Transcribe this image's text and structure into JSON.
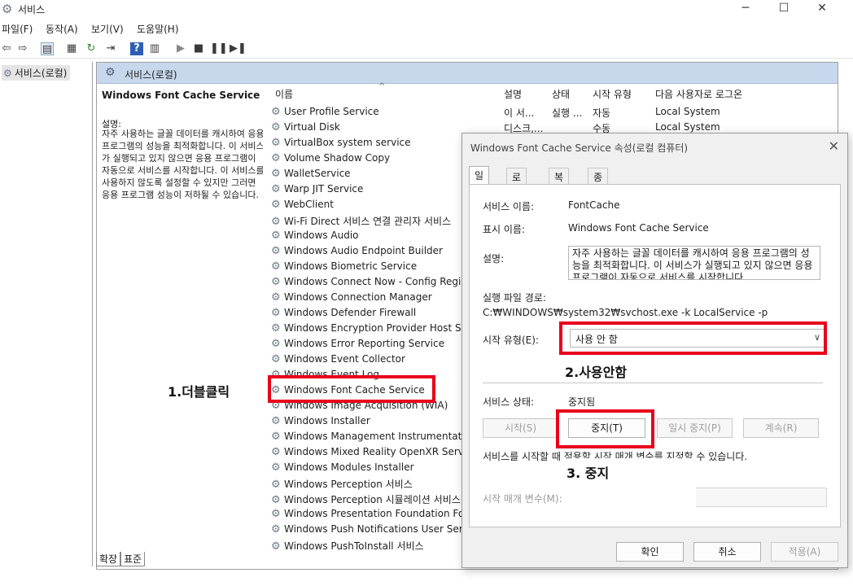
{
  "window": {
    "title": "서비스",
    "minimize": "─",
    "maximize": "☐",
    "close": "✕"
  },
  "menu": [
    "파일(F)",
    "동작(A)",
    "보기(V)",
    "도움말(H)"
  ],
  "tree": {
    "root": "서비스(로컬)"
  },
  "pane": {
    "header": "서비스(로컬)",
    "selected_name": "Windows Font Cache Service",
    "desc_label": "설명:",
    "desc_text": "자주 사용하는 글꼴 데이터를 캐시하여 응용 프로그램의 성능을 최적화합니다. 이 서비스가 실행되고 있지 않으면 응용 프로그램이 자동으로 서비스를 시작합니다. 이 서비스를 사용하지 않도록 설정할 수 있지만 그러면 응용 프로그램 성능이 저하될 수 있습니다."
  },
  "columns": {
    "name": "이름",
    "desc": "설명",
    "status": "상태",
    "startup": "시작 유형",
    "logon": "다음 사용자로 로그온"
  },
  "services": [
    "User Profile Service",
    "Virtual Disk",
    "VirtualBox system service",
    "Volume Shadow Copy",
    "WalletService",
    "Warp JIT Service",
    "WebClient",
    "Wi-Fi Direct 서비스 연결 관리자 서비스",
    "Windows Audio",
    "Windows Audio Endpoint Builder",
    "Windows Biometric Service",
    "Windows Connect Now - Config Registrar",
    "Windows Connection Manager",
    "Windows Defender Firewall",
    "Windows Encryption Provider Host Service",
    "Windows Error Reporting Service",
    "Windows Event Collector",
    "Windows Event Log",
    "Windows Font Cache Service",
    "Windows Image Acquisition (WIA)",
    "Windows Installer",
    "Windows Management Instrumentation",
    "Windows Mixed Reality OpenXR Service",
    "Windows Modules Installer",
    "Windows Perception 서비스",
    "Windows Perception 시뮬레이션 서비스",
    "Windows Presentation Foundation Font Cache",
    "Windows Push Notifications User Service",
    "Windows PushToInstall 서비스"
  ],
  "visible_rows": [
    {
      "desc": "이 서...",
      "status": "실행 ...",
      "startup": "자동",
      "logon": "Local System"
    },
    {
      "desc": "디스크,...",
      "status": "",
      "startup": "수동",
      "logon": "Local System"
    }
  ],
  "bottom_tabs": [
    "확장",
    "표준"
  ],
  "dialog": {
    "title": "Windows Font Cache Service 속성(로컬 컴퓨터)",
    "close": "✕",
    "tabs": [
      "일반",
      "로그온",
      "복구",
      "종속성"
    ],
    "service_name_label": "서비스 이름:",
    "service_name": "FontCache",
    "display_name_label": "표시 이름:",
    "display_name": "Windows Font Cache Service",
    "desc_label": "설명:",
    "desc_text": "자주 사용하는 글꼴 데이터를 캐시하여 응용 프로그램의 성능을 최적화합니다. 이 서비스가 실행되고 있지 않으면 응용 프로그램이 자동으로 서비스를 시작합니다.",
    "exe_path_label": "실행 파일 경로:",
    "exe_path": "C:₩WINDOWS₩system32₩svchost.exe -k LocalService -p",
    "startup_type_label": "시작 유형(E):",
    "startup_type_value": "사용 안 함",
    "service_status_label": "서비스 상태:",
    "service_status": "중지됨",
    "buttons": {
      "start": "시작(S)",
      "stop": "중지(T)",
      "pause": "일시 중지(P)",
      "resume": "계속(R)"
    },
    "hint": "서비스를 시작할 때 적용할 시작 매개 변수를 지정할 수 있습니다.",
    "param_label": "시작 매개 변수(M):",
    "ok": "확인",
    "cancel": "취소",
    "apply": "적용(A)"
  },
  "annotations": {
    "step1": "1.더블클릭",
    "step2": "2.사용안함",
    "step3": "3. 중지",
    "highlight_color": "#e8001c"
  }
}
